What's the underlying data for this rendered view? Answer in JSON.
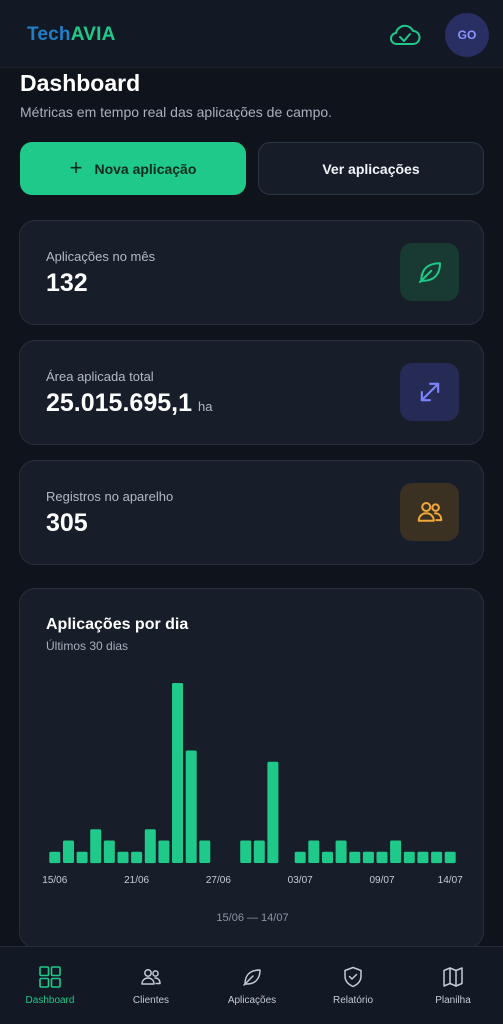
{
  "app": {
    "logo_part1": "Tech",
    "logo_part2": "AVIA",
    "avatar_initials": "GO"
  },
  "page": {
    "title": "Dashboard",
    "subtitle": "Métricas em tempo real das aplicações de campo."
  },
  "actions": {
    "new_label": "Nova aplicação",
    "view_label": "Ver aplicações"
  },
  "stats": [
    {
      "label": "Aplicações no mês",
      "value": "132",
      "unit": "",
      "icon": "leaf-icon",
      "color": "#1fc98a",
      "bg": "#183a32"
    },
    {
      "label": "Área aplicada total",
      "value": "25.015.695,1",
      "unit": "ha",
      "icon": "expand-arrows-icon",
      "color": "#7c83ff",
      "bg": "#262b55"
    },
    {
      "label": "Registros no aparelho",
      "value": "305",
      "unit": "",
      "icon": "users-icon",
      "color": "#f2a93b",
      "bg": "#3b3123"
    }
  ],
  "chart": {
    "title": "Aplicações por dia",
    "subtitle": "Últimos 30 dias",
    "range": "15/06 — 14/07"
  },
  "chart_data": {
    "type": "bar",
    "color": "#1fc98a",
    "categories": [
      "15/06",
      "16/06",
      "17/06",
      "18/06",
      "19/06",
      "20/06",
      "21/06",
      "22/06",
      "23/06",
      "24/06",
      "25/06",
      "26/06",
      "27/06",
      "28/06",
      "29/06",
      "30/06",
      "01/07",
      "02/07",
      "03/07",
      "04/07",
      "05/07",
      "06/07",
      "07/07",
      "08/07",
      "09/07",
      "10/07",
      "11/07",
      "12/07",
      "13/07",
      "14/07"
    ],
    "values": [
      1,
      2,
      1,
      3,
      2,
      1,
      1,
      3,
      2,
      16,
      10,
      2,
      0,
      0,
      2,
      2,
      9,
      0,
      1,
      2,
      1,
      2,
      1,
      1,
      1,
      2,
      1,
      1,
      1,
      1
    ],
    "tick_labels": [
      "15/06",
      "21/06",
      "27/06",
      "03/07",
      "09/07",
      "14/07"
    ],
    "ylim": [
      0,
      16
    ],
    "grid": false
  },
  "nav": [
    {
      "label": "Dashboard",
      "icon": "grid-icon",
      "active": true
    },
    {
      "label": "Clientes",
      "icon": "users-icon",
      "active": false
    },
    {
      "label": "Aplicações",
      "icon": "leaf-icon",
      "active": false
    },
    {
      "label": "Relatório",
      "icon": "shield-check-icon",
      "active": false
    },
    {
      "label": "Planilha",
      "icon": "map-icon",
      "active": false
    }
  ]
}
